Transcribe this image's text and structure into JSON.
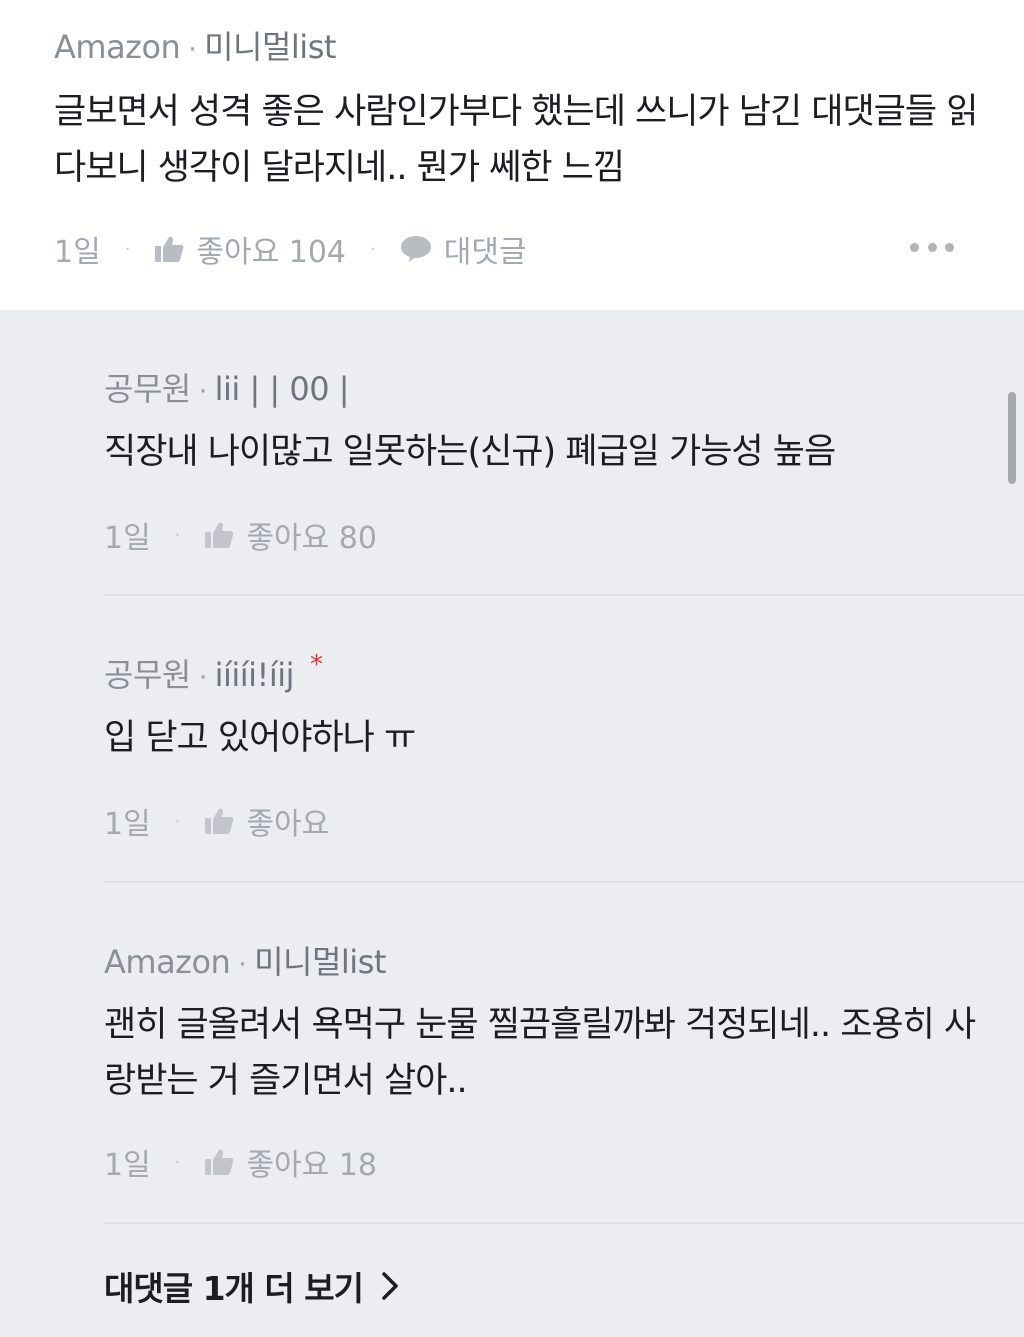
{
  "parent_comment": {
    "company": "Amazon",
    "nickname": "미니멀list",
    "body": "글보면서 성격 좋은 사람인가부다 했는데 쓰니가 남긴 대댓글들 읽다보니 생각이 달라지네.. 뭔가 쎄한 느낌",
    "time": "1일",
    "like_label": "좋아요 104",
    "reply_label": "대댓글"
  },
  "replies": [
    {
      "company": "공무원",
      "nickname": "lii |  | 00 |",
      "body": "직장내 나이많고 일못하는(신규) 폐급일 가능성 높음",
      "time": "1일",
      "like_label": "좋아요 80"
    },
    {
      "company": "공무원",
      "nickname": "iíiíi!íij",
      "new_mark": "*",
      "body": "입 닫고 있어야하나 ㅠ",
      "time": "1일",
      "like_label": "좋아요"
    },
    {
      "company": "Amazon",
      "nickname": "미니멀list",
      "body": "괜히 글올려서 욕먹구 눈물 찔끔흘릴까봐 걱정되네.. 조용히 사랑받는 거 즐기면서 살아..",
      "time": "1일",
      "like_label": "좋아요 18"
    }
  ],
  "more_replies_label": "대댓글 1개 더 보기",
  "separator_dot": "·",
  "icons": {
    "like": "thumbs-up-icon",
    "reply": "speech-bubble-icon",
    "more": "more-dots-icon",
    "chevron": "chevron-right-icon"
  },
  "colors": {
    "new_mark": "#e0353b",
    "reply_background": "#ebedf1"
  }
}
